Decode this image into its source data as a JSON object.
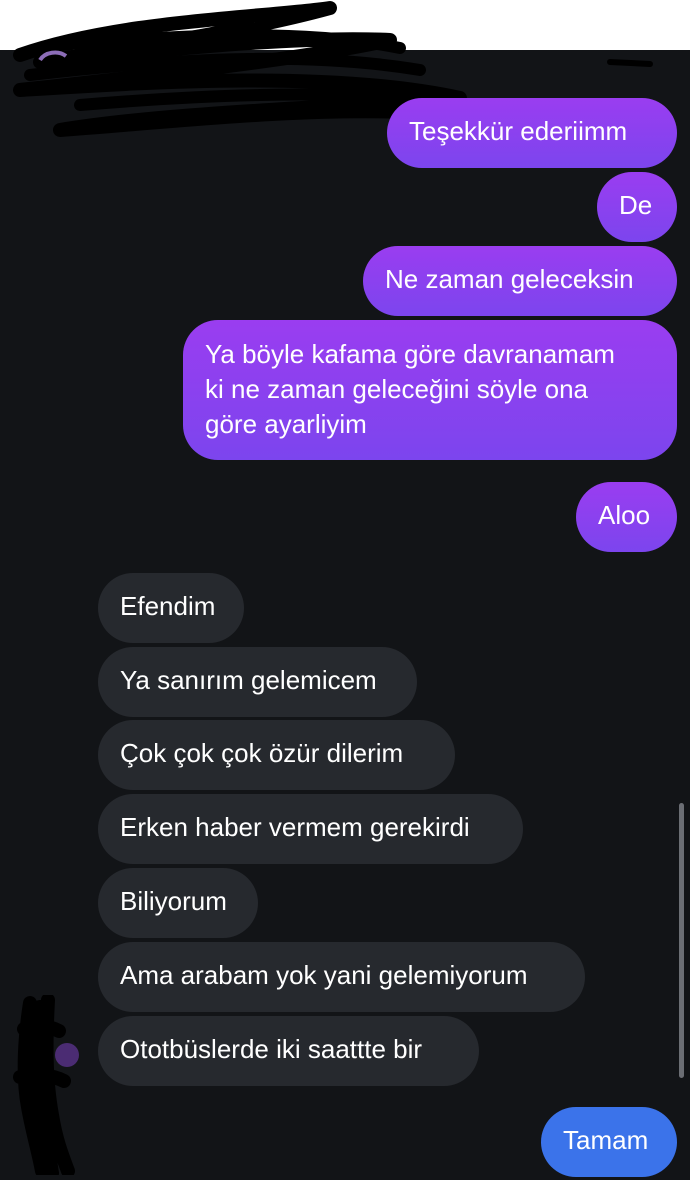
{
  "messages": [
    {
      "id": "m1",
      "direction": "outgoing",
      "text": "Teşekkür ederiimm"
    },
    {
      "id": "m2",
      "direction": "outgoing",
      "text": "De"
    },
    {
      "id": "m3",
      "direction": "outgoing",
      "text": "Ne zaman geleceksin"
    },
    {
      "id": "m4",
      "direction": "outgoing",
      "lines": [
        "Ya böyle kafama göre davranamam",
        "ki ne zaman geleceğini söyle ona",
        "göre ayarliyim"
      ]
    },
    {
      "id": "m5",
      "direction": "outgoing",
      "text": "Aloo"
    },
    {
      "id": "m6",
      "direction": "incoming",
      "text": "Efendim"
    },
    {
      "id": "m7",
      "direction": "incoming",
      "text": "Ya sanırım gelemicem"
    },
    {
      "id": "m8",
      "direction": "incoming",
      "text": "Çok çok çok özür dilerim"
    },
    {
      "id": "m9",
      "direction": "incoming",
      "text": "Erken haber vermem gerekirdi"
    },
    {
      "id": "m10",
      "direction": "incoming",
      "text": "Biliyorum"
    },
    {
      "id": "m11",
      "direction": "incoming",
      "text": "Ama arabam yok yani gelemiyorum"
    },
    {
      "id": "m12",
      "direction": "incoming",
      "text": "Ototbüslerde iki saattte bir"
    },
    {
      "id": "m13",
      "direction": "outgoing",
      "text": "Tamam"
    }
  ],
  "colors": {
    "background": "#121417",
    "outgoing_bubble": "#8842ee",
    "incoming_bubble": "#26292e",
    "latest_outgoing_bubble": "#3b73ea",
    "text": "#ffffff"
  },
  "icons": {
    "redaction": "redaction-scribble",
    "avatar": "avatar-icon"
  }
}
